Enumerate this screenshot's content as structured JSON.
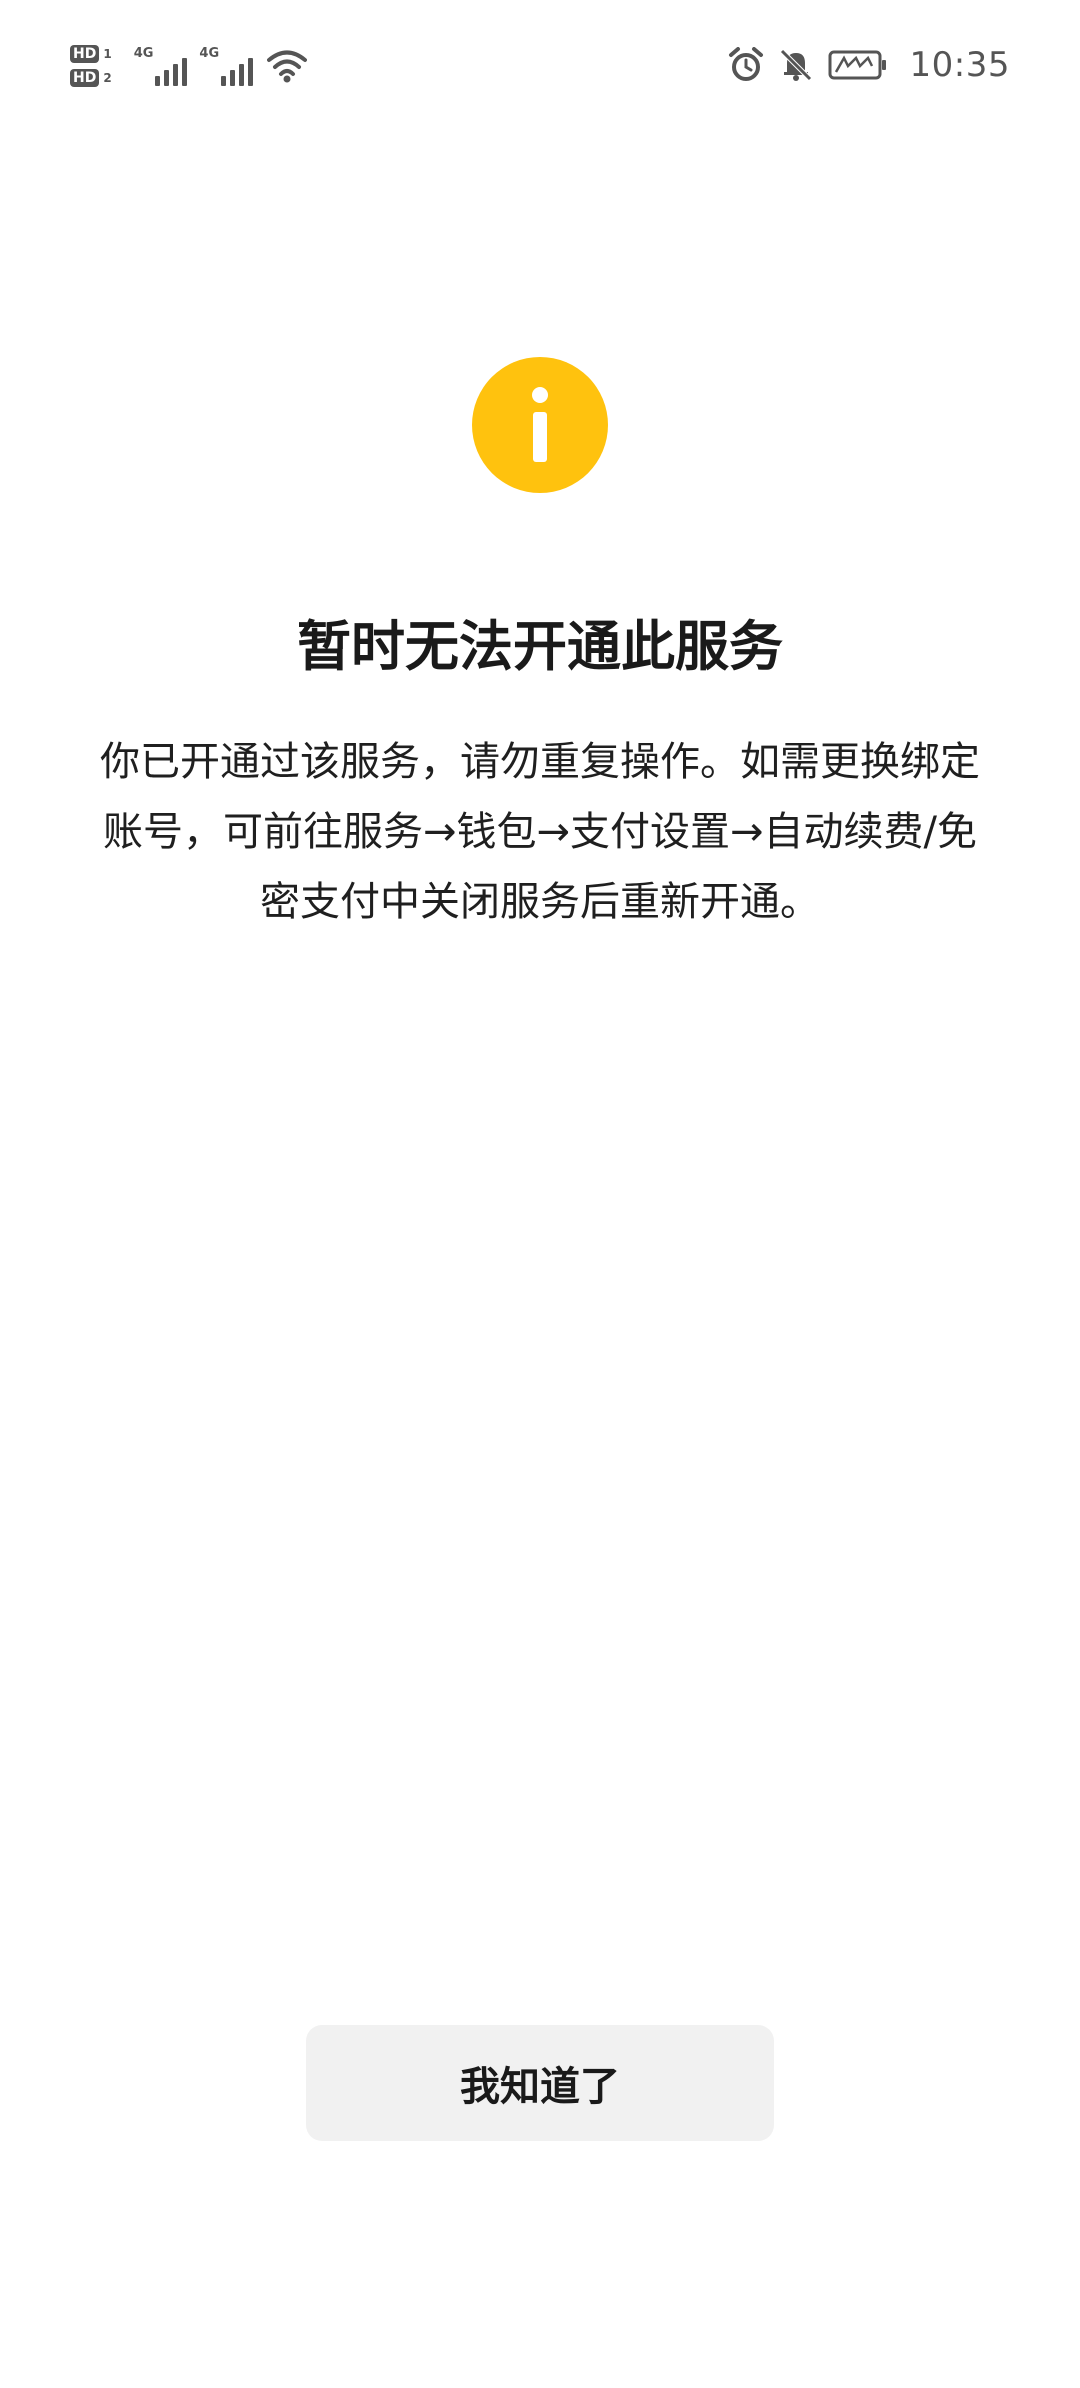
{
  "status_bar": {
    "sim1_badge": "HD",
    "sim1_index": "1",
    "sim2_badge": "HD",
    "sim2_index": "2",
    "network1": "4G",
    "network2": "4G",
    "time": "10:35",
    "icons": [
      "alarm-icon",
      "mute-bell-icon",
      "battery-charging-icon",
      "wifi-icon",
      "signal-icon"
    ]
  },
  "dialog": {
    "icon": "info-icon",
    "icon_color": "#FFC20E",
    "title": "暂时无法开通此服务",
    "description": "你已开通过该服务，请勿重复操作。如需更换绑定账号，可前往服务→钱包→支付设置→自动续费/免密支付中关闭服务后重新开通。",
    "confirm_button": "我知道了"
  }
}
